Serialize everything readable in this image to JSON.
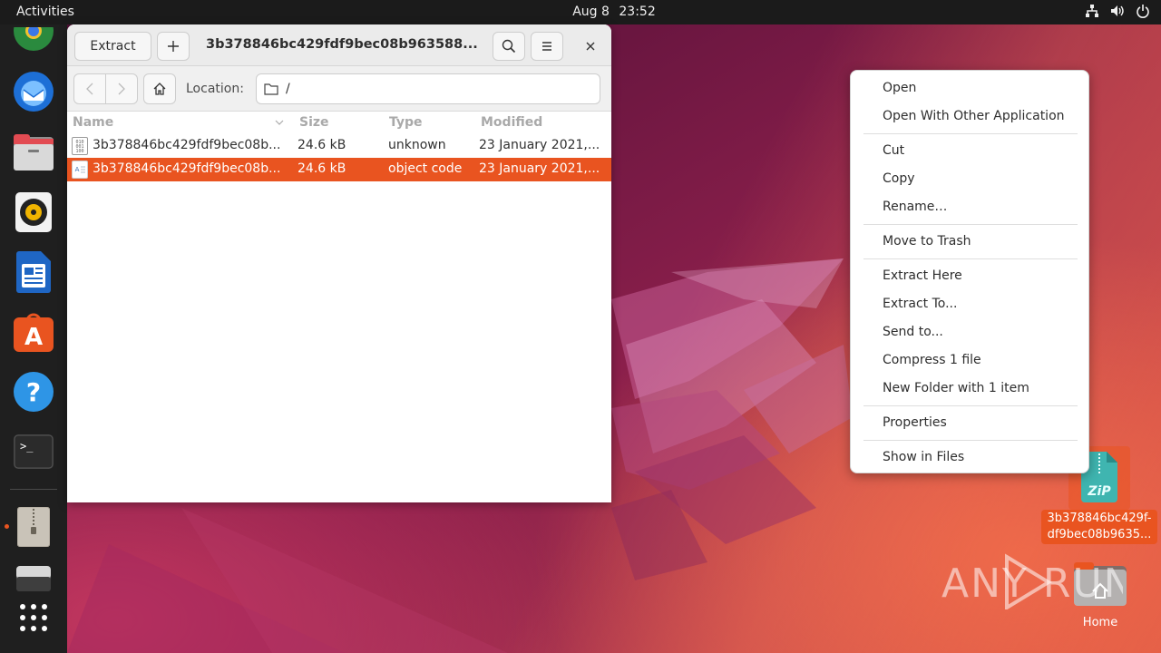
{
  "topbar": {
    "activities": "Activities",
    "date": "Aug 8",
    "time": "23:52"
  },
  "dock": {
    "apps": [
      "chrome-icon",
      "thunderbird-icon",
      "files-icon",
      "rhythmbox-icon",
      "writer-icon",
      "app-center-icon",
      "help-icon",
      "terminal-icon",
      "archive-manager-icon",
      "drive-icon",
      "show-apps-icon"
    ]
  },
  "window": {
    "extract_label": "Extract",
    "title": "3b378846bc429fdf9bec08b963588...",
    "location_label": "Location:",
    "location_value": "/",
    "columns": [
      "Name",
      "Size",
      "Type",
      "Modified"
    ],
    "rows": [
      {
        "name": "3b378846bc429fdf9bec08b...",
        "size": "24.6 kB",
        "type": "unknown",
        "modified": "23 January 2021,..."
      },
      {
        "name": "3b378846bc429fdf9bec08b...",
        "size": "24.6 kB",
        "type": "object code",
        "modified": "23 January 2021,..."
      }
    ]
  },
  "context_menu": {
    "items": [
      "Open",
      "Open With Other Application",
      "Cut",
      "Copy",
      "Rename…",
      "Move to Trash",
      "Extract Here",
      "Extract To...",
      "Send to...",
      "Compress 1 file",
      "New Folder with 1 item",
      "Properties",
      "Show in Files"
    ]
  },
  "desktop": {
    "zip_icon_text": "ZiP",
    "zip_label_line1": "3b378846bc429f-",
    "zip_label_line2": "df9bec08b9635...",
    "home_label": "Home",
    "watermark": "ANY RUN"
  },
  "colors": {
    "accent": "#e95420",
    "topbar": "#1b1b1b",
    "dock": "#1f1f1f"
  }
}
